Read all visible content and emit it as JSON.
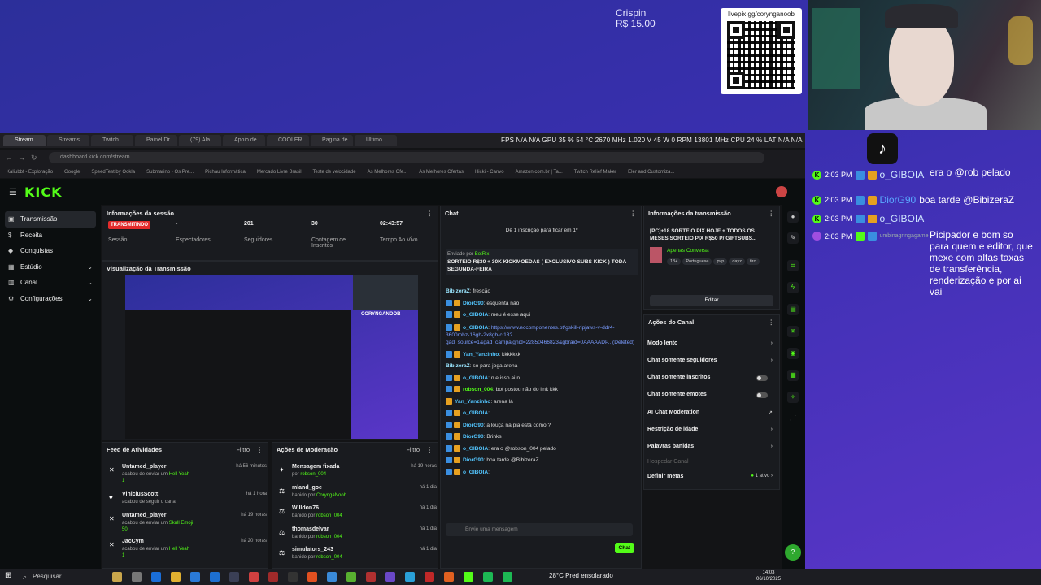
{
  "overlay": {
    "donor_name": "Crispin",
    "donor_amount": "R$ 15.00",
    "qr_url": "livepix.gg/corynganoob",
    "chat_top_text": "era o @rob pelado",
    "chat": [
      {
        "time": "2:03 PM",
        "user": "o_GIBOIA",
        "msg": ""
      },
      {
        "time": "2:03 PM",
        "user": "DiorG90",
        "msg": "boa tarde @BibizeraZ"
      },
      {
        "time": "2:03 PM",
        "user": "o_GIBOIA",
        "msg": ""
      },
      {
        "time": "2:03 PM",
        "user": "umbinagringagame",
        "msg": ""
      }
    ],
    "long_msg": "Picipador e bom so para quem e editor, que mexe com altas taxas de transferência, renderização e por ai vai"
  },
  "browser": {
    "tabs": [
      "Stream",
      "Streams",
      "Twitch",
      "Painel Dr...",
      "(79) Ala...",
      "Apoio de",
      "COOLER",
      "Pagina de",
      "Ultimo"
    ],
    "perf": "FPS  N/A   N/A   GPU  35 %  54 °C  2670 MHz  1.020 V  45 W  0 RPM  13801 MHz   CPU  24 %    LAT  N/A  N/A",
    "url": "dashboard.kick.com/stream",
    "bookmarks": [
      "Kaliubbf - Exploração",
      "Google",
      "SpeedTest by Ookla",
      "Submarino - Os Pre...",
      "Pichau Informática",
      "Mercado Livre Brasil",
      "Teste de velocidade",
      "As Melhores Ofe...",
      "As Melhores Ofertas",
      "Hicki - Canvo",
      "Amazon.com.br | Ta...",
      "Twitch Relief Maker",
      "Eler and Customiza..."
    ]
  },
  "kick": {
    "logo": "KICK",
    "nav": [
      {
        "label": "Transmissão",
        "icon": "▣"
      },
      {
        "label": "Receita",
        "icon": "$"
      },
      {
        "label": "Conquistas",
        "icon": "◆"
      },
      {
        "label": "Estúdio",
        "icon": "▦"
      },
      {
        "label": "Canal",
        "icon": "▥"
      },
      {
        "label": "Configurações",
        "icon": "⚙"
      }
    ],
    "session": {
      "title": "Informações da sessão",
      "status": "TRANSMITINDO",
      "stats": [
        {
          "value": "",
          "label": "Sessão"
        },
        {
          "value": "-",
          "label": "Espectadores"
        },
        {
          "value": "201",
          "label": "Seguidores"
        },
        {
          "value": "30",
          "label": "Contagem de Inscritos"
        },
        {
          "value": "02:43:57",
          "label": "Tempo Ao Vivo"
        }
      ]
    },
    "preview": {
      "title": "Visualização da Transmissão",
      "cam_name": "CORYNGANOOB"
    },
    "feed": {
      "title": "Feed de Atividades",
      "filter": "Filtro",
      "items": [
        {
          "name": "Untamed_player",
          "time": "há 56 minutos",
          "sub": "acabou de enviar um",
          "gift": "Hell Yeah",
          "kick": "1"
        },
        {
          "name": "ViniciusScott",
          "time": "há 1 hora",
          "sub": "acabou de seguir o canal",
          "gift": "",
          "kick": ""
        },
        {
          "name": "Untamed_player",
          "time": "há 19 horas",
          "sub": "acabou de enviar um",
          "gift": "Skull Emoji",
          "kick": "50"
        },
        {
          "name": "JacCym",
          "time": "há 20 horas",
          "sub": "acabou de enviar um",
          "gift": "Hell Yeah",
          "kick": "1"
        }
      ]
    },
    "mod": {
      "title": "Ações de Moderação",
      "filter": "Filtro",
      "items": [
        {
          "name": "Mensagem fixada",
          "by": "por",
          "who": "robson_004",
          "time": "há 19 horas"
        },
        {
          "name": "mland_goe",
          "by": "banido por",
          "who": "CoryngaNoob",
          "time": "há 1 dia"
        },
        {
          "name": "Willdon76",
          "by": "banido por",
          "who": "robson_004",
          "time": "há 1 dia"
        },
        {
          "name": "thomasdelvar",
          "by": "banido por",
          "who": "robson_004",
          "time": "há 1 dia"
        },
        {
          "name": "simulators_243",
          "by": "banido por",
          "who": "robson_004",
          "time": "há 1 dia"
        }
      ]
    },
    "chat": {
      "title": "Chat",
      "sub_notice": "Dê 1 inscrição para ficar em 1º",
      "pinned_by": "Enviado por",
      "pinned_user": "BotRix",
      "pinned_msg": "SORTEIO R$30 + 30K KICKMOEDAS ( EXCLUSIVO SUBS KICK ) TODA SEGUNDA-FEIRA",
      "messages": [
        {
          "user": "BibizeraZ",
          "text": "frescão",
          "cls": "u2"
        },
        {
          "user": "DiorG90",
          "text": "esquenta não",
          "cls": "u"
        },
        {
          "user": "o_GIBOIA",
          "text": "meu é esse aqui",
          "cls": "u"
        },
        {
          "user": "o_GIBOIA",
          "text": "https://www.eccomponentes.pt/gskill-ripjaws-v-ddr4-3600mhz-16gb-2x8gb-cl18?gad_source=1&gad_campaignid=22850466823&gbraid=0AAAAADP.. (Deleted)",
          "cls": "u"
        },
        {
          "user": "Yan_Yanzinho",
          "text": "kkkkkkk",
          "cls": "u"
        },
        {
          "user": "BibizeraZ",
          "text": "so para joga arena",
          "cls": "u2"
        },
        {
          "user": "o_GIBOIA",
          "text": "n e isso ai n",
          "cls": "u"
        },
        {
          "user": "robson_004",
          "text": "bot gostou não do link kkk",
          "cls": "u3"
        },
        {
          "user": "Yan_Yanzinho",
          "text": "arena lá",
          "cls": "u"
        },
        {
          "user": "o_GIBOIA",
          "text": "",
          "cls": "u"
        },
        {
          "user": "DiorG90",
          "text": "a louça na pia está como ?",
          "cls": "u"
        },
        {
          "user": "DiorG90",
          "text": "Brinks",
          "cls": "u"
        },
        {
          "user": "o_GIBOIA",
          "text": "era o @robson_004 pelado",
          "cls": "u"
        },
        {
          "user": "DiorG90",
          "text": "boa tarde @BibizeraZ",
          "cls": "u"
        },
        {
          "user": "o_GIBOIA",
          "text": "",
          "cls": "u"
        }
      ],
      "input_placeholder": "Envie uma mensagem",
      "send": "Chat"
    },
    "info": {
      "title": "Informações da transmissão",
      "stream_title": "[PC]+18 SORTEIO PIX HOJE + TODOS OS MESES SORTEIO PIX R$50 P/ GIFTSUBS...",
      "category": "Apenas Conversa",
      "tags": [
        "18+",
        "Portuguese",
        "pvp",
        "dayz",
        "tiro"
      ],
      "edit": "Editar"
    },
    "actions": {
      "title": "Ações do Canal",
      "items": [
        {
          "label": "Modo lento",
          "kind": "arrow"
        },
        {
          "label": "Chat somente seguidores",
          "kind": "arrow"
        },
        {
          "label": "Chat somente inscritos",
          "kind": "toggle"
        },
        {
          "label": "Chat somente emotes",
          "kind": "toggle"
        },
        {
          "label": "AI Chat Moderation",
          "kind": "ext"
        },
        {
          "label": "Restrição de idade",
          "kind": "arrow"
        },
        {
          "label": "Palavras banidas",
          "kind": "arrow"
        },
        {
          "label": "Hospedar Canal",
          "kind": "disabled"
        },
        {
          "label": "Definir metas",
          "kind": "meta"
        }
      ],
      "meta_status": "1 ativo"
    }
  },
  "taskbar": {
    "search": "Pesquisar",
    "weather": "28°C  Pred ensolarado",
    "time": "14:03",
    "date": "06/10/2025"
  }
}
